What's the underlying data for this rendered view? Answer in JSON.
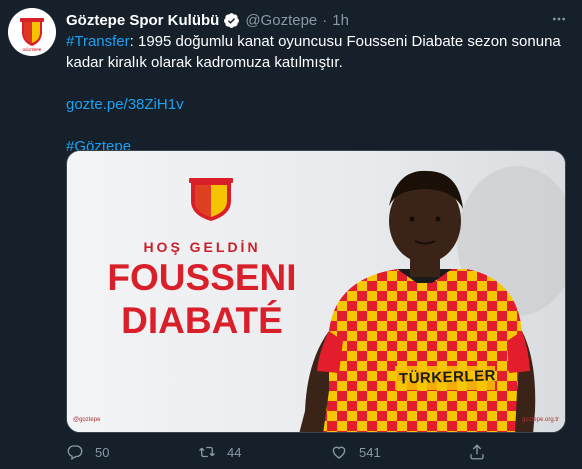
{
  "tweet": {
    "display_name": "Göztepe Spor Kulübü",
    "handle": "@Goztepe",
    "separator": "·",
    "time": "1h",
    "avatar_text": "GÖZTEPE",
    "text": {
      "hashtag_transfer": "#Transfer",
      "body": ": 1995 doğumlu kanat oyuncusu Fousseni Diabate sezon sonuna kadar kiralık olarak kadromuza katılmıştır.",
      "link": "gozte.pe/38ZiH1v",
      "hashtag_club": "#Göztepe"
    },
    "media": {
      "welcome": "HOŞ GELDİN",
      "first_name": "FOUSSENI",
      "last_name": "DIABATÉ",
      "sponsor": "TÜRKERLER",
      "handle_tag": "@goztepe",
      "site_tag": "goztepe.org.tr"
    },
    "actions": {
      "replies": "50",
      "retweets": "44",
      "likes": "541"
    }
  },
  "icons": [
    "verified-badge-icon",
    "more-icon",
    "reply-icon",
    "retweet-icon",
    "like-icon",
    "share-icon"
  ],
  "colors": {
    "background": "#15202b",
    "link": "#1da1f2",
    "muted": "#8899a6",
    "brand_red": "#d91f2a",
    "brand_yellow": "#f5c400"
  }
}
